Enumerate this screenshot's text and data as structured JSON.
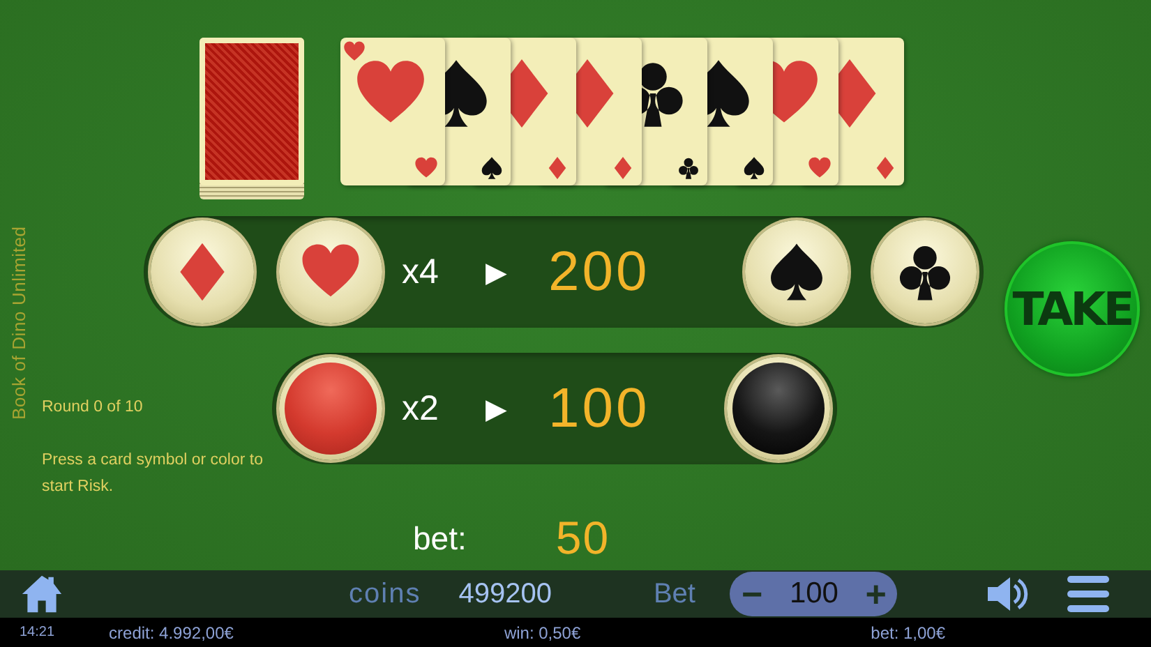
{
  "cards": [
    {
      "kind": "heart"
    },
    {
      "kind": "spade"
    },
    {
      "kind": "diamond"
    },
    {
      "kind": "diamond"
    },
    {
      "kind": "club"
    },
    {
      "kind": "spade"
    },
    {
      "kind": "heart"
    },
    {
      "kind": "diamond"
    }
  ],
  "side_title": "Book of Dino Unlimited",
  "round": "Round 0 of 10",
  "hint": "Press a card symbol or color to start Risk.",
  "suit_row": {
    "left_buttons": [
      {
        "kind": "diamond"
      },
      {
        "kind": "heart"
      }
    ],
    "multiplier": "x4",
    "arrow": "▶",
    "win": "200",
    "right_buttons": [
      {
        "kind": "spade"
      },
      {
        "kind": "club"
      }
    ]
  },
  "color_row": {
    "left_buttons": [
      {
        "kind": "red"
      }
    ],
    "multiplier": "x2",
    "arrow": "▶",
    "win": "100",
    "right_buttons": [
      {
        "kind": "black"
      }
    ]
  },
  "take_button": "TAKE",
  "bet": {
    "label": "bet:",
    "value": "50"
  },
  "bottom_bar": {
    "coins_label": "coins",
    "coins_value": "499200",
    "bet_label": "Bet",
    "stepper": {
      "minus": "−",
      "value": "100",
      "plus": "+"
    }
  },
  "status_bar": {
    "time": "14:21",
    "credit": "credit: 4.992,00€",
    "win": "win: 0,50€",
    "bet": "bet: 1,00€"
  }
}
